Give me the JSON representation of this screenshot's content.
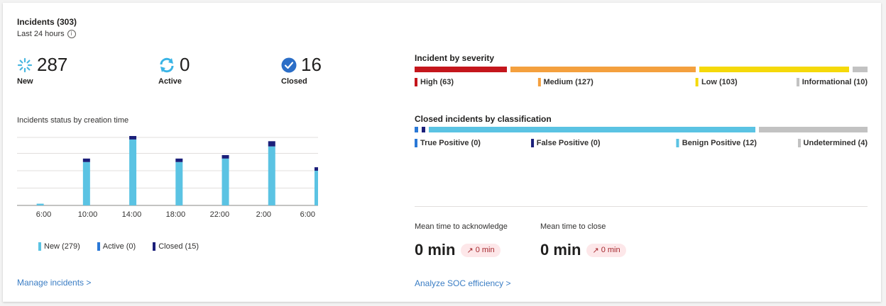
{
  "header": {
    "title": "Incidents (303)",
    "subtitle": "Last 24 hours",
    "info_icon": "i"
  },
  "stats": {
    "new": {
      "value": "287",
      "label": "New",
      "icon": "spinner-icon",
      "color": "#4ab7e0"
    },
    "active": {
      "value": "0",
      "label": "Active",
      "icon": "refresh-icon",
      "color": "#3ab4e6"
    },
    "closed": {
      "value": "16",
      "label": "Closed",
      "icon": "check-circle-icon",
      "color": "#2b6ec7"
    }
  },
  "status_chart": {
    "title": "Incidents status by creation time",
    "legend": {
      "new": "New (279)",
      "active": "Active (0)",
      "closed": "Closed (15)"
    },
    "colors": {
      "new": "#5bc3e3",
      "active": "#2a78d6",
      "closed": "#1b1f7a"
    }
  },
  "chart_data": {
    "type": "bar",
    "categories": [
      "6:00",
      "10:00",
      "14:00",
      "18:00",
      "22:00",
      "2:00",
      "6:00"
    ],
    "series": [
      {
        "name": "New (279)",
        "values": [
          1,
          25,
          38,
          25,
          27,
          34,
          20
        ]
      },
      {
        "name": "Active (0)",
        "values": [
          0,
          0,
          0,
          0,
          0,
          0,
          0
        ]
      },
      {
        "name": "Closed (15)",
        "values": [
          0,
          2,
          2,
          2,
          2,
          3,
          2
        ]
      }
    ],
    "bar_slots": [
      0,
      2,
      4,
      6,
      8,
      10,
      12
    ],
    "tick_slots": [
      0.8,
      2.7,
      4.6,
      6.5,
      8.4,
      10.3,
      12.2
    ],
    "stacked": true,
    "grid": true,
    "ylim": [
      0,
      40
    ],
    "title": "Incidents status by creation time"
  },
  "severity": {
    "title": "Incident by severity",
    "segments": [
      {
        "label": "High (63)",
        "value": 63,
        "color": "#c4161c"
      },
      {
        "label": "Medium (127)",
        "value": 127,
        "color": "#f4a03e"
      },
      {
        "label": "Low (103)",
        "value": 103,
        "color": "#f5d90a"
      },
      {
        "label": "Informational (10)",
        "value": 10,
        "color": "#c2c2c2"
      }
    ]
  },
  "classification": {
    "title": "Closed incidents by classification",
    "segments": [
      {
        "label": "True Positive (0)",
        "value": 0,
        "color": "#2a78d6"
      },
      {
        "label": "False Positive (0)",
        "value": 0,
        "color": "#1b1f7a"
      },
      {
        "label": "Benign Positive (12)",
        "value": 12,
        "color": "#5bc3e3"
      },
      {
        "label": "Undetermined (4)",
        "value": 4,
        "color": "#c2c2c2"
      }
    ]
  },
  "metrics": {
    "ack": {
      "label": "Mean time to acknowledge",
      "value": "0 min",
      "delta": "0 min"
    },
    "close": {
      "label": "Mean time to close",
      "value": "0 min",
      "delta": "0 min"
    }
  },
  "links": {
    "manage": "Manage incidents >",
    "analyze": "Analyze SOC efficiency >"
  }
}
